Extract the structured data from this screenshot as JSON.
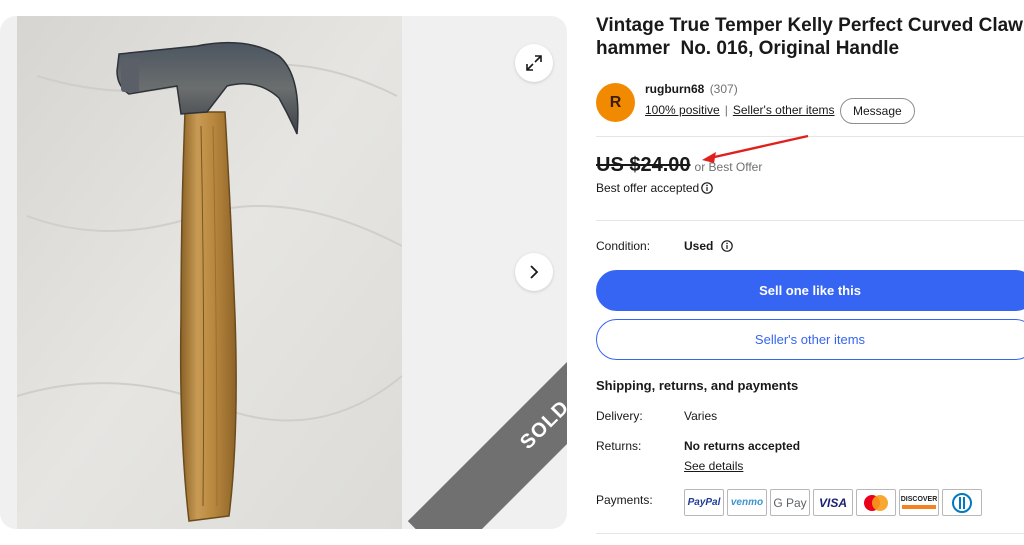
{
  "listing": {
    "title": "Vintage True Temper Kelly Perfect Curved Claw hammer  No. 016, Original Handle",
    "sold_banner": "SOLD"
  },
  "gallery": {
    "expand_icon": "expand-icon",
    "next_icon": "chevron-right-icon"
  },
  "seller": {
    "avatar_letter": "R",
    "avatar_color": "#f18a00",
    "name": "rugburn68",
    "score": "(307)",
    "positive": "100% positive",
    "other_items_link": "Seller's other items",
    "message_button": "Message"
  },
  "price": {
    "amount": "US $24.00",
    "best_offer": "or Best Offer",
    "accepted": "Best offer accepted"
  },
  "condition": {
    "label": "Condition:",
    "value": "Used"
  },
  "actions": {
    "sell_one": "Sell one like this",
    "sellers_other_items": "Seller's other items",
    "primary_color": "#3665f3"
  },
  "shipping": {
    "heading": "Shipping, returns, and payments",
    "delivery_label": "Delivery:",
    "delivery_value": "Varies",
    "returns_label": "Returns:",
    "returns_value": "No returns accepted",
    "see_details": "See details",
    "payments_label": "Payments:",
    "methods": [
      "PayPal",
      "venmo",
      "G Pay",
      "VISA",
      "Mastercard",
      "DISCOVER",
      "Diners Club"
    ]
  },
  "annotation": {
    "arrow_color": "#e0201b"
  }
}
